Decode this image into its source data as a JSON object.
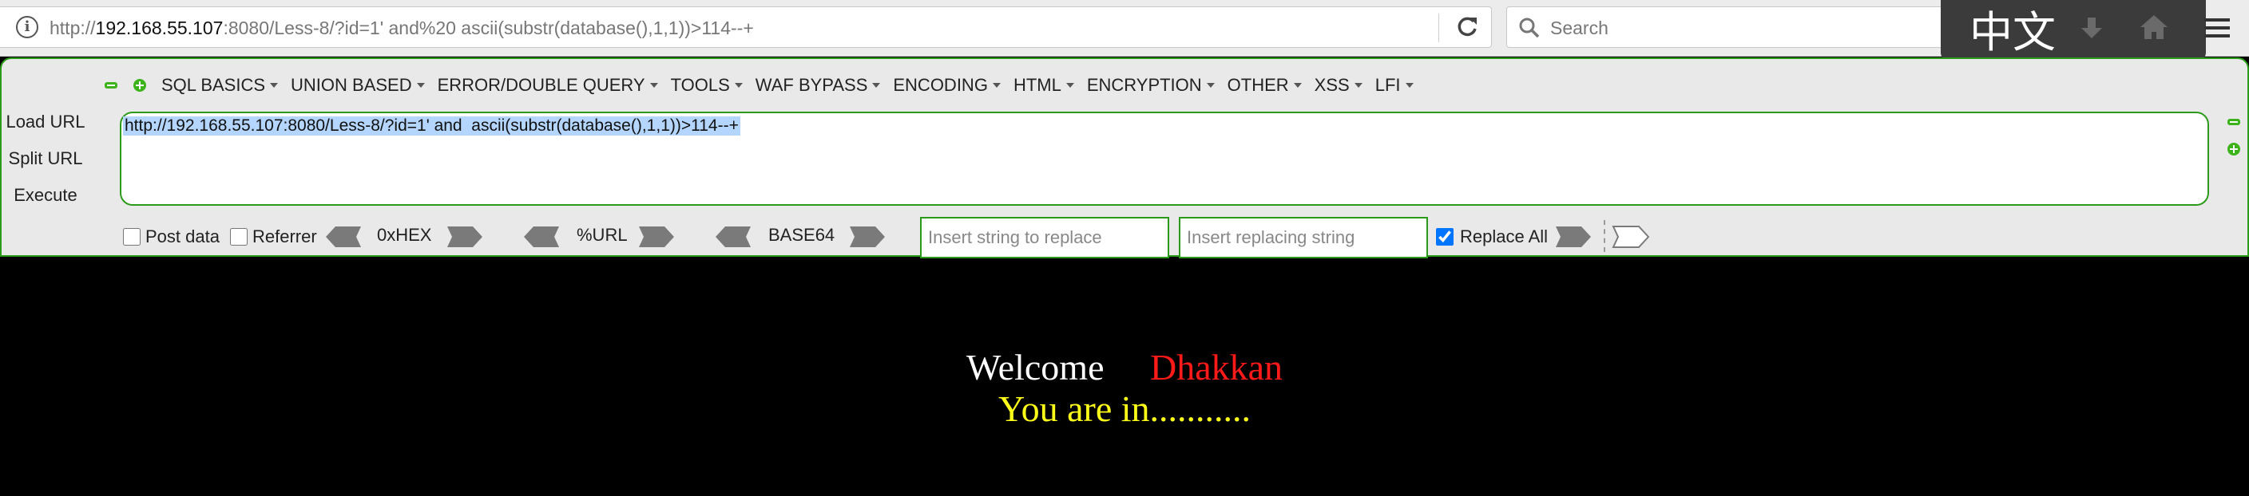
{
  "browser": {
    "url": {
      "scheme": "http://",
      "host": "192.168.55.107",
      "rest": ":8080/Less-8/?id=1' and%20 ascii(substr(database(),1,1))>114--+"
    },
    "search_placeholder": "Search",
    "ime_label": "中文"
  },
  "hackbar": {
    "menu": [
      "SQL BASICS",
      "UNION BASED",
      "ERROR/DOUBLE QUERY",
      "TOOLS",
      "WAF BYPASS",
      "ENCODING",
      "HTML",
      "ENCRYPTION",
      "OTHER",
      "XSS",
      "LFI"
    ],
    "actions": {
      "load_url": "Load URL",
      "split_url": "Split URL",
      "execute": "Execute"
    },
    "textarea_value": "http://192.168.55.107:8080/Less-8/?id=1' and  ascii(substr(database(),1,1))>114--+",
    "options": {
      "post_data": "Post data",
      "referrer": "Referrer",
      "post_data_checked": false,
      "referrer_checked": false
    },
    "encoders": {
      "hex": "0xHEX",
      "url": "%URL",
      "base64": "BASE64"
    },
    "replace": {
      "find_placeholder": "Insert string to replace",
      "replace_placeholder": "Insert replacing string",
      "replace_all_label": "Replace All",
      "replace_all_checked": true
    }
  },
  "page": {
    "welcome_word": "Welcome",
    "welcome_name": "Dhakkan",
    "status": "You are in..........."
  },
  "colors": {
    "hackbar_border": "#2b9a1a",
    "welcome_name": "#ff1a1a",
    "status": "#ffff1a",
    "selection": "#b4d5fe"
  }
}
